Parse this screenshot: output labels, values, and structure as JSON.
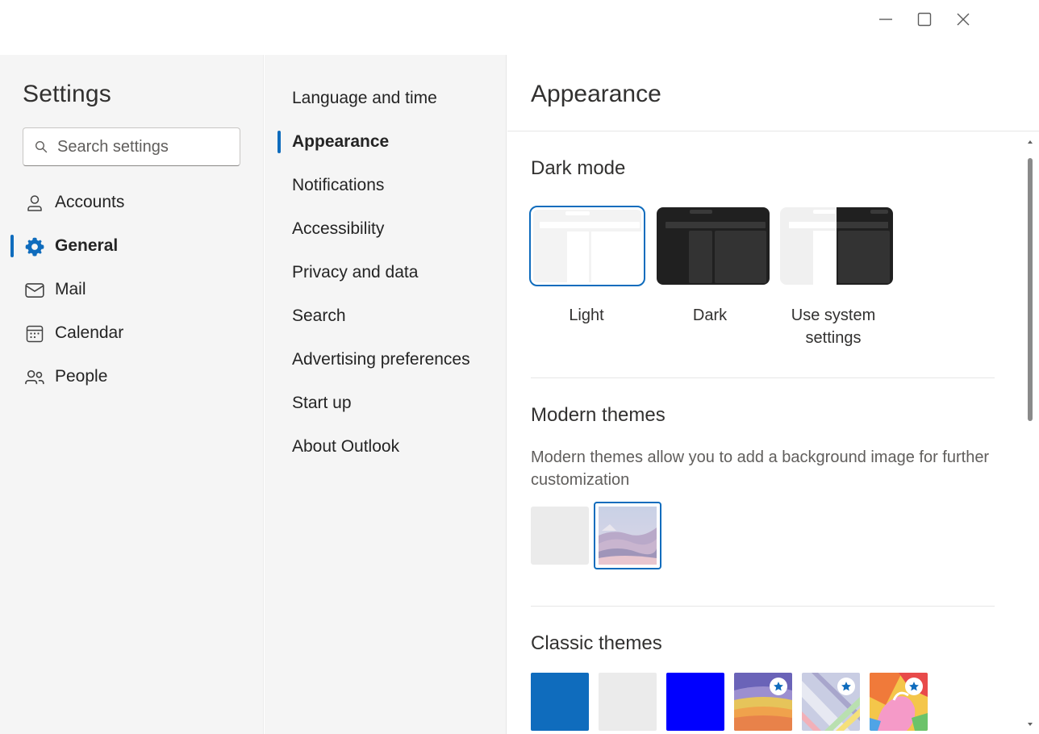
{
  "window": {
    "controls": [
      "minimize-icon",
      "maximize-icon",
      "close-icon"
    ]
  },
  "sidebar": {
    "title": "Settings",
    "search_placeholder": "Search settings",
    "items": [
      {
        "label": "Accounts",
        "icon": "person-icon"
      },
      {
        "label": "General",
        "icon": "gear-icon",
        "active": true
      },
      {
        "label": "Mail",
        "icon": "mail-icon"
      },
      {
        "label": "Calendar",
        "icon": "calendar-icon"
      },
      {
        "label": "People",
        "icon": "people-icon"
      }
    ]
  },
  "subnav": {
    "items": [
      {
        "label": "Language and time"
      },
      {
        "label": "Appearance",
        "active": true
      },
      {
        "label": "Notifications"
      },
      {
        "label": "Accessibility"
      },
      {
        "label": "Privacy and data"
      },
      {
        "label": "Search"
      },
      {
        "label": "Advertising preferences"
      },
      {
        "label": "Start up"
      },
      {
        "label": "About Outlook"
      }
    ]
  },
  "main": {
    "title": "Appearance",
    "dark_mode": {
      "title": "Dark mode",
      "options": [
        {
          "label": "Light",
          "selected": true
        },
        {
          "label": "Dark"
        },
        {
          "label": "Use system settings"
        }
      ]
    },
    "modern_themes": {
      "title": "Modern themes",
      "description": "Modern themes allow you to add a background image for further customization",
      "selected_index": 1
    },
    "classic_themes": {
      "title": "Classic themes",
      "colors": [
        "#0f6cbd",
        "#ebebeb",
        "#0000ff"
      ]
    }
  },
  "colors": {
    "accent": "#0f6cbd",
    "nav_bg": "#f5f5f5",
    "text": "#242424"
  }
}
